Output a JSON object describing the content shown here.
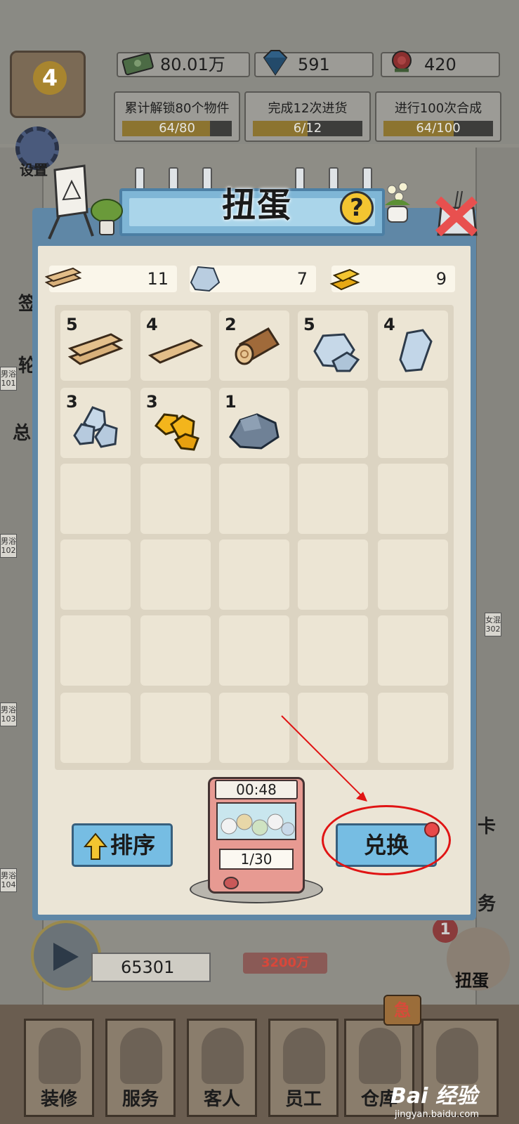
{
  "top_bar": {
    "level": "4",
    "currencies": [
      {
        "icon": "cash-icon",
        "value": "80.01万"
      },
      {
        "icon": "diamond-icon",
        "value": "591"
      },
      {
        "icon": "rose-icon",
        "value": "420"
      }
    ],
    "tasks": [
      {
        "name": "累计解锁80个物件",
        "progress": "64/80",
        "fraction": 0.8
      },
      {
        "name": "完成12次进货",
        "progress": "6/12",
        "fraction": 0.5
      },
      {
        "name": "进行100次合成",
        "progress": "64/100",
        "fraction": 0.64
      }
    ],
    "settings_label": "设置"
  },
  "background": {
    "room_tags": [
      "男浴101",
      "男浴102",
      "男浴103",
      "男浴104",
      "女混302"
    ],
    "side_labels": [
      "签",
      "轮",
      "总",
      "卡",
      "务"
    ],
    "coins_value": "65301",
    "price_value": "3200万",
    "gacha_badge": "1",
    "gacha_label": "扭蛋"
  },
  "modal": {
    "title": "扭蛋",
    "resources": [
      {
        "icon": "wood-plank-icon",
        "value": "11"
      },
      {
        "icon": "stone-icon",
        "value": "7"
      },
      {
        "icon": "gold-bar-icon",
        "value": "9"
      }
    ],
    "items": [
      {
        "icon": "wood-planks-icon",
        "qty": "5"
      },
      {
        "icon": "wood-plank-icon",
        "qty": "4"
      },
      {
        "icon": "log-icon",
        "qty": "2"
      },
      {
        "icon": "silver-ore-icon",
        "qty": "5"
      },
      {
        "icon": "crystal-icon",
        "qty": "4"
      },
      {
        "icon": "rock-pile-icon",
        "qty": "3"
      },
      {
        "icon": "gold-ore-icon",
        "qty": "3"
      },
      {
        "icon": "dark-rock-icon",
        "qty": "1"
      }
    ],
    "sort_label": "排序",
    "exchange_label": "兑换",
    "machine": {
      "timer": "00:48",
      "counter": "1/30"
    }
  },
  "bottom_nav": {
    "items": [
      "装修",
      "服务",
      "客人",
      "员工",
      "仓库"
    ],
    "urgent_badge": "急"
  },
  "watermark": {
    "brand": "Bai 经验",
    "url": "jingyan.baidu.com"
  },
  "colors": {
    "panel_blue": "#5f87a6",
    "panel_bg": "#ebe5d6",
    "button_blue": "#76bde3",
    "annotation_red": "#e01414"
  }
}
